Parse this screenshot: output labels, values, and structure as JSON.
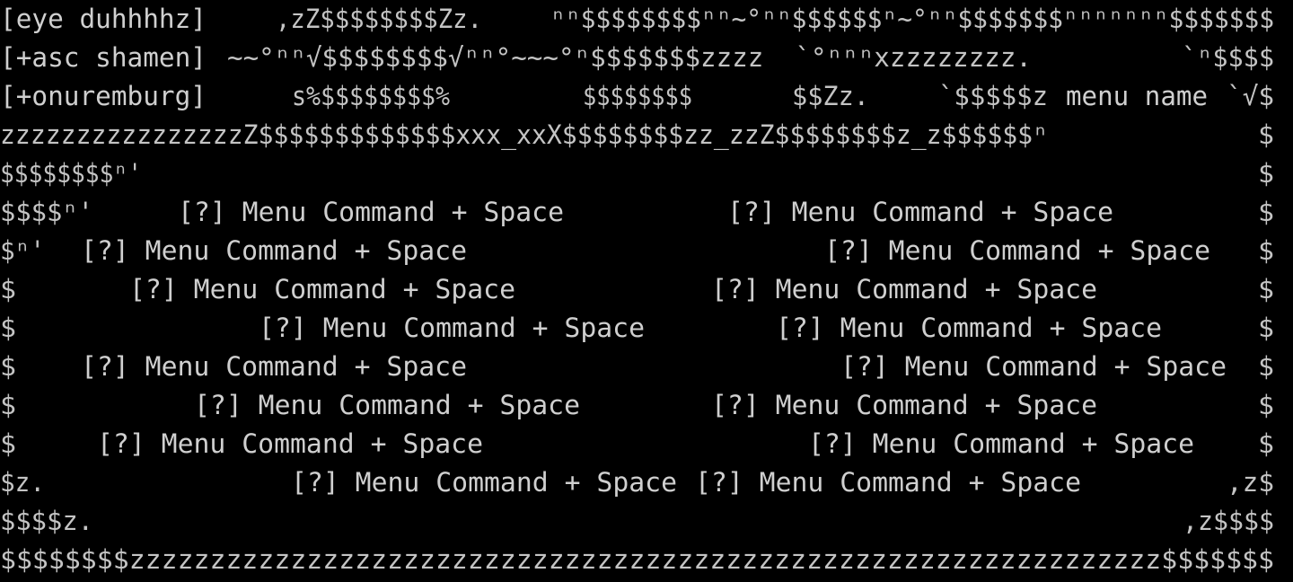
{
  "screen": {
    "theme": {
      "background": "#000000",
      "foreground": "#c4c4c4"
    }
  },
  "top_menu": {
    "item_1": "[eye duhhhhz]",
    "item_2": "[+asc shamen]",
    "item_3": "[+onuremburg]",
    "menu_name": "menu name"
  },
  "art": {
    "r1_a": ",zZ$$$$$$$$Zz.",
    "r1_b": "ⁿⁿ$$$$$$$$ⁿⁿ~°ⁿⁿ$$$$$$ⁿ~°ⁿⁿ$$$$$$$ⁿⁿⁿⁿⁿⁿⁿ$$$$$$$",
    "r2_a": "~~°ⁿⁿ√$$$$$$$$√ⁿⁿ°~~~°ⁿ$$$$$$$zzzz  `°ⁿⁿⁿxzzzzzzzz.",
    "r2_b": "`ⁿ$$$$",
    "r3_a": "s%$$$$$$$$%",
    "r3_b": "$$$$$$$$",
    "r3_c": "$$Zz.",
    "r3_d": "`$$$$$z",
    "r3_e": "`√$",
    "r4_a": "zzzzzzzzzzzzzzzzZ$$$$$$$$$$$$$xxx_xxX$$$$$$$$zz_zzZ$$$$$$$$z_z$$$$$$ⁿ",
    "r4_b": "$",
    "r5_a": "$$$$$$$$ⁿ'",
    "r5_b": "$",
    "r6_a": "$$$$ⁿ'",
    "r6_b": "$",
    "r7_a": "$ⁿ'",
    "r7_b": "$",
    "r8_a": "$",
    "r8_b": "$",
    "r9_a": "$",
    "r9_b": "$",
    "r10_a": "$",
    "r10_b": "$",
    "r11_a": "$",
    "r11_b": "$",
    "r12_a": "$",
    "r12_b": "$",
    "r13_a": "$z.",
    "r13_b": ",z$",
    "r14_a": "$$$$z.",
    "r14_b": ",z$$$$",
    "r15_a": "$$$$$$$$zzzzzzzzzzzzzzzzzzzzzzzzzzzzzzzzzzzzzzzzzzzzzzzzzzzzzzzzzzzzzzzz$$$$$$$"
  },
  "commands": [
    {
      "label": "[?] Menu Command + Space"
    },
    {
      "label": "[?] Menu Command + Space"
    },
    {
      "label": "[?] Menu Command + Space"
    },
    {
      "label": "[?] Menu Command + Space"
    },
    {
      "label": "[?] Menu Command + Space"
    },
    {
      "label": "[?] Menu Command + Space"
    },
    {
      "label": "[?] Menu Command + Space"
    },
    {
      "label": "[?] Menu Command + Space"
    },
    {
      "label": "[?] Menu Command + Space"
    },
    {
      "label": "[?] Menu Command + Space"
    },
    {
      "label": "[?] Menu Command + Space"
    },
    {
      "label": "[?] Menu Command + Space"
    },
    {
      "label": "[?] Menu Command + Space"
    },
    {
      "label": "[?] Menu Command + Space"
    },
    {
      "label": "[?] Menu Command + Space"
    },
    {
      "label": "[?] Menu Command + Space"
    }
  ]
}
